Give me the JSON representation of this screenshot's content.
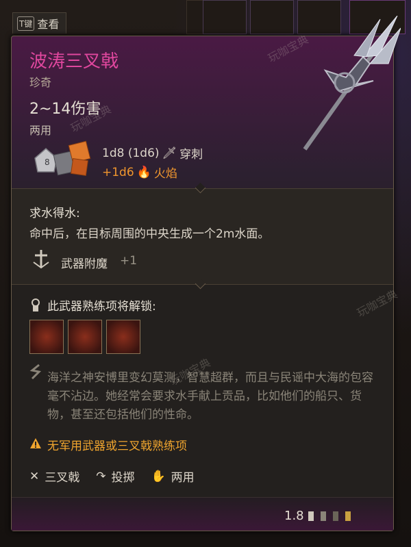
{
  "header": {
    "key": "T键",
    "examine_label": "查看"
  },
  "item": {
    "name": "波涛三叉戟",
    "rarity": "珍奇",
    "damage_range": "2~14伤害",
    "handedness": "两用",
    "base_damage_dice": "1d8 (1d6)",
    "base_damage_type": "穿刺",
    "bonus_damage_dice": "+1d6",
    "bonus_damage_type": "火焰"
  },
  "passive": {
    "name": "求水得水:",
    "description": "命中后，在目标周围的中央生成一个2m水面。"
  },
  "enchantment": {
    "label": "武器附魔",
    "value": "+1"
  },
  "proficiency": {
    "title": "此武器熟练项将解锁:"
  },
  "flavor": "海洋之神安博里变幻莫测，智慧超群，而且与民谣中大海的包容毫不沾边。她经常会要求水手献上贡品，比如他们的船只、货物，甚至还包括他们的性命。",
  "warning": "无军用武器或三叉戟熟练项",
  "tags": [
    "三叉戟",
    "投掷",
    "两用"
  ],
  "footer": {
    "weight": "1.8"
  },
  "watermark": "玩咖宝典",
  "colors": {
    "title": "#e0479e",
    "fire": "#f0962e",
    "warning": "#f0a52e"
  },
  "icons": [
    "trident-image",
    "dice-icon",
    "pierce-icon",
    "fire-icon",
    "enchantment-icon",
    "lock-unlock-icon",
    "quote-icon",
    "warning-icon",
    "trident-type-icon",
    "throw-icon",
    "hand-icon"
  ]
}
